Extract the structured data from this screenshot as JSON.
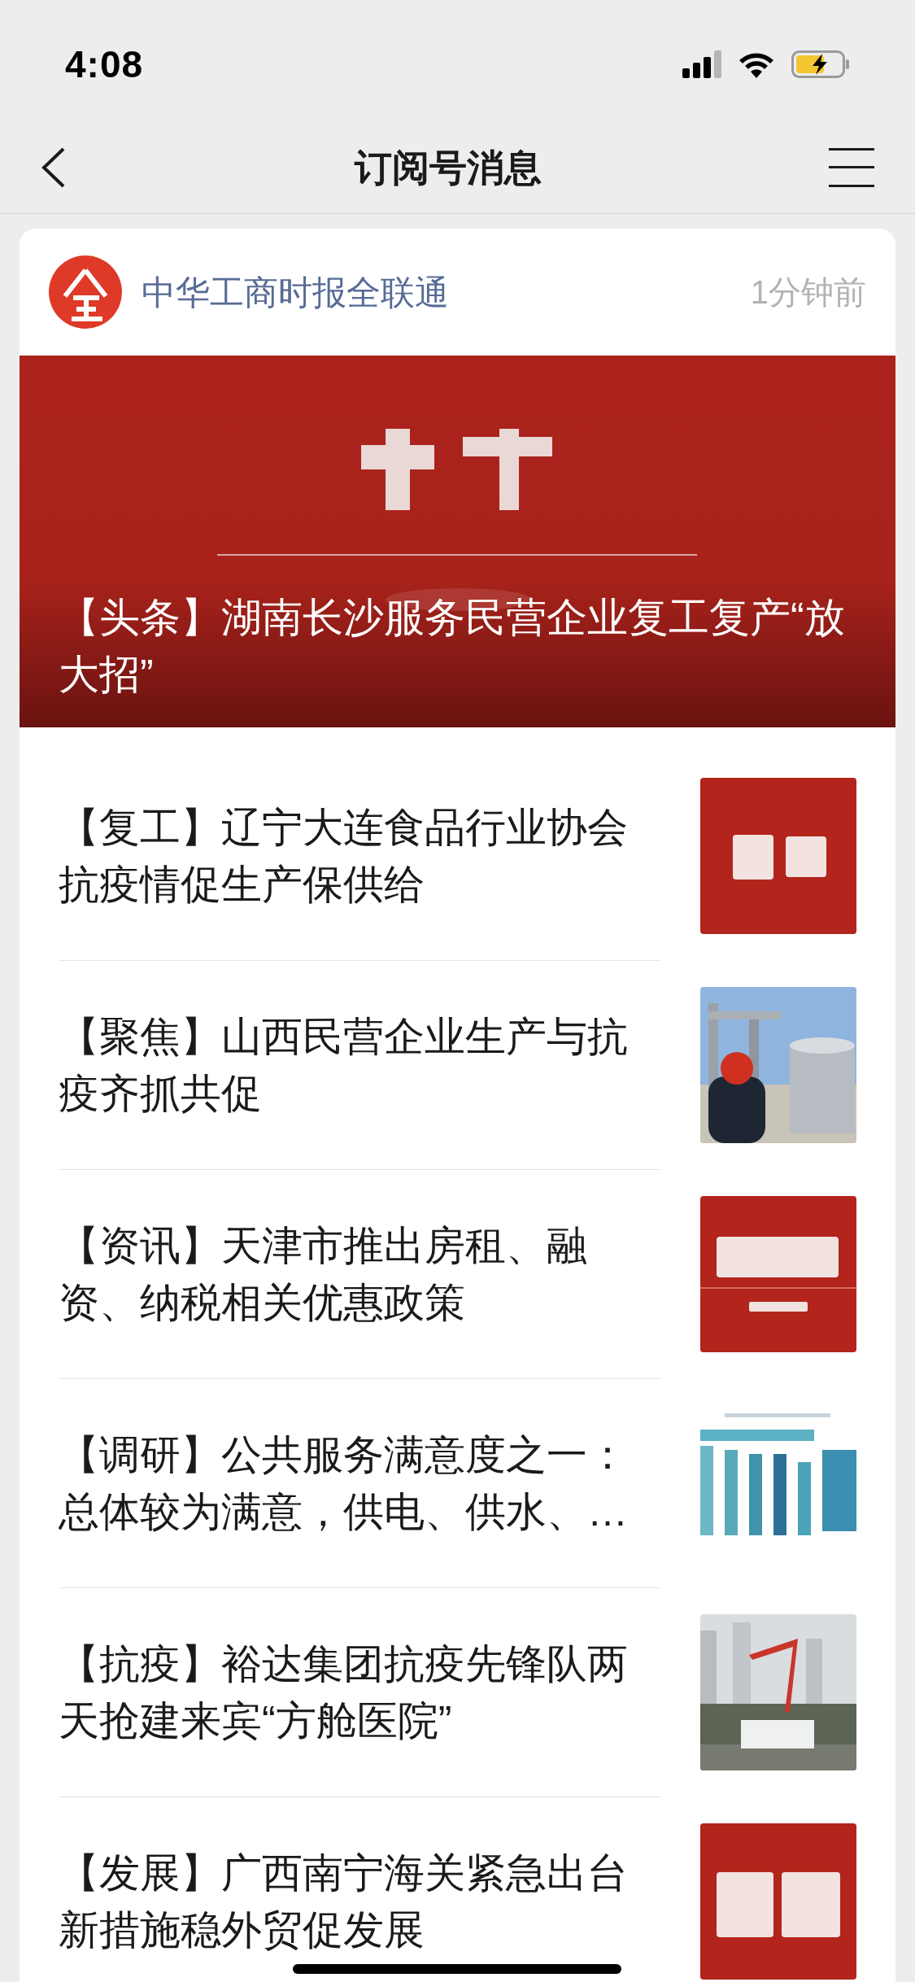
{
  "status_bar": {
    "time": "4:08"
  },
  "nav_bar": {
    "title": "订阅号消息"
  },
  "account": {
    "name": "中华工商时报全联通",
    "time": "1分钟前"
  },
  "hero": {
    "headline": "【头条】湖南长沙服务民营企业复工复产“放大招”"
  },
  "articles": [
    {
      "headline": "【复工】辽宁大连食品行业协会抗疫情促生产保供给"
    },
    {
      "headline": "【聚焦】山西民营企业生产与抗疫齐抓共促"
    },
    {
      "headline": "【资讯】天津市推出房租、融资、纳税相关优惠政策"
    },
    {
      "headline": "【调研】公共服务满意度之一：总体较为满意，供电、供水、…"
    },
    {
      "headline": "【抗疫】裕达集团抗疫先锋队两天抢建来宾“方舱医院”"
    },
    {
      "headline": "【发展】广西南宁海关紧急出台新措施稳外贸促发展"
    }
  ]
}
